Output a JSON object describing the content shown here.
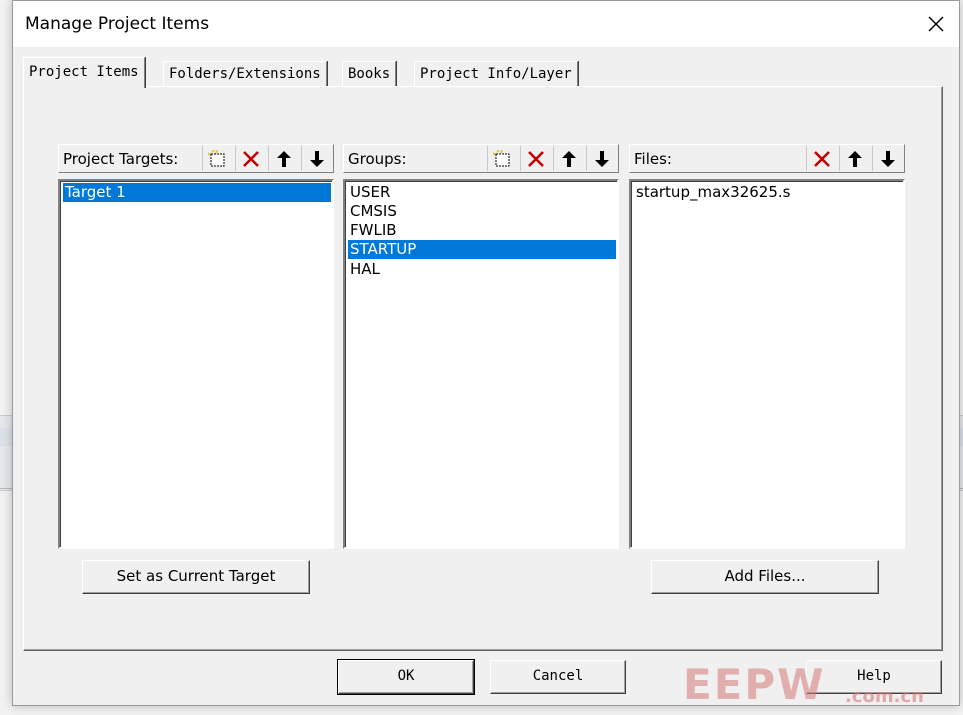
{
  "dialog": {
    "title": "Manage Project Items"
  },
  "tabs": [
    {
      "label": "Project Items",
      "active": true
    },
    {
      "label": "Folders/Extensions",
      "active": false
    },
    {
      "label": "Books",
      "active": false
    },
    {
      "label": "Project Info/Layer",
      "active": false
    }
  ],
  "targets": {
    "label": "Project Targets:",
    "items": [
      "Target 1"
    ],
    "selected": "Target 1"
  },
  "groups": {
    "label": "Groups:",
    "items": [
      "USER",
      "CMSIS",
      "FWLIB",
      "STARTUP",
      "HAL"
    ],
    "selected": "STARTUP"
  },
  "files": {
    "label": "Files:",
    "items": [
      "startup_max32625.s"
    ],
    "selected": ""
  },
  "buttons": {
    "set_current": "Set as Current Target",
    "add_files": "Add Files...",
    "ok": "OK",
    "cancel": "Cancel",
    "help": "Help"
  },
  "watermark": {
    "text": "EEPW",
    "sub": ".com.cn"
  },
  "colors": {
    "selection": "#0078d7",
    "delete_icon": "#c00000",
    "new_icon": "#e8c830"
  }
}
